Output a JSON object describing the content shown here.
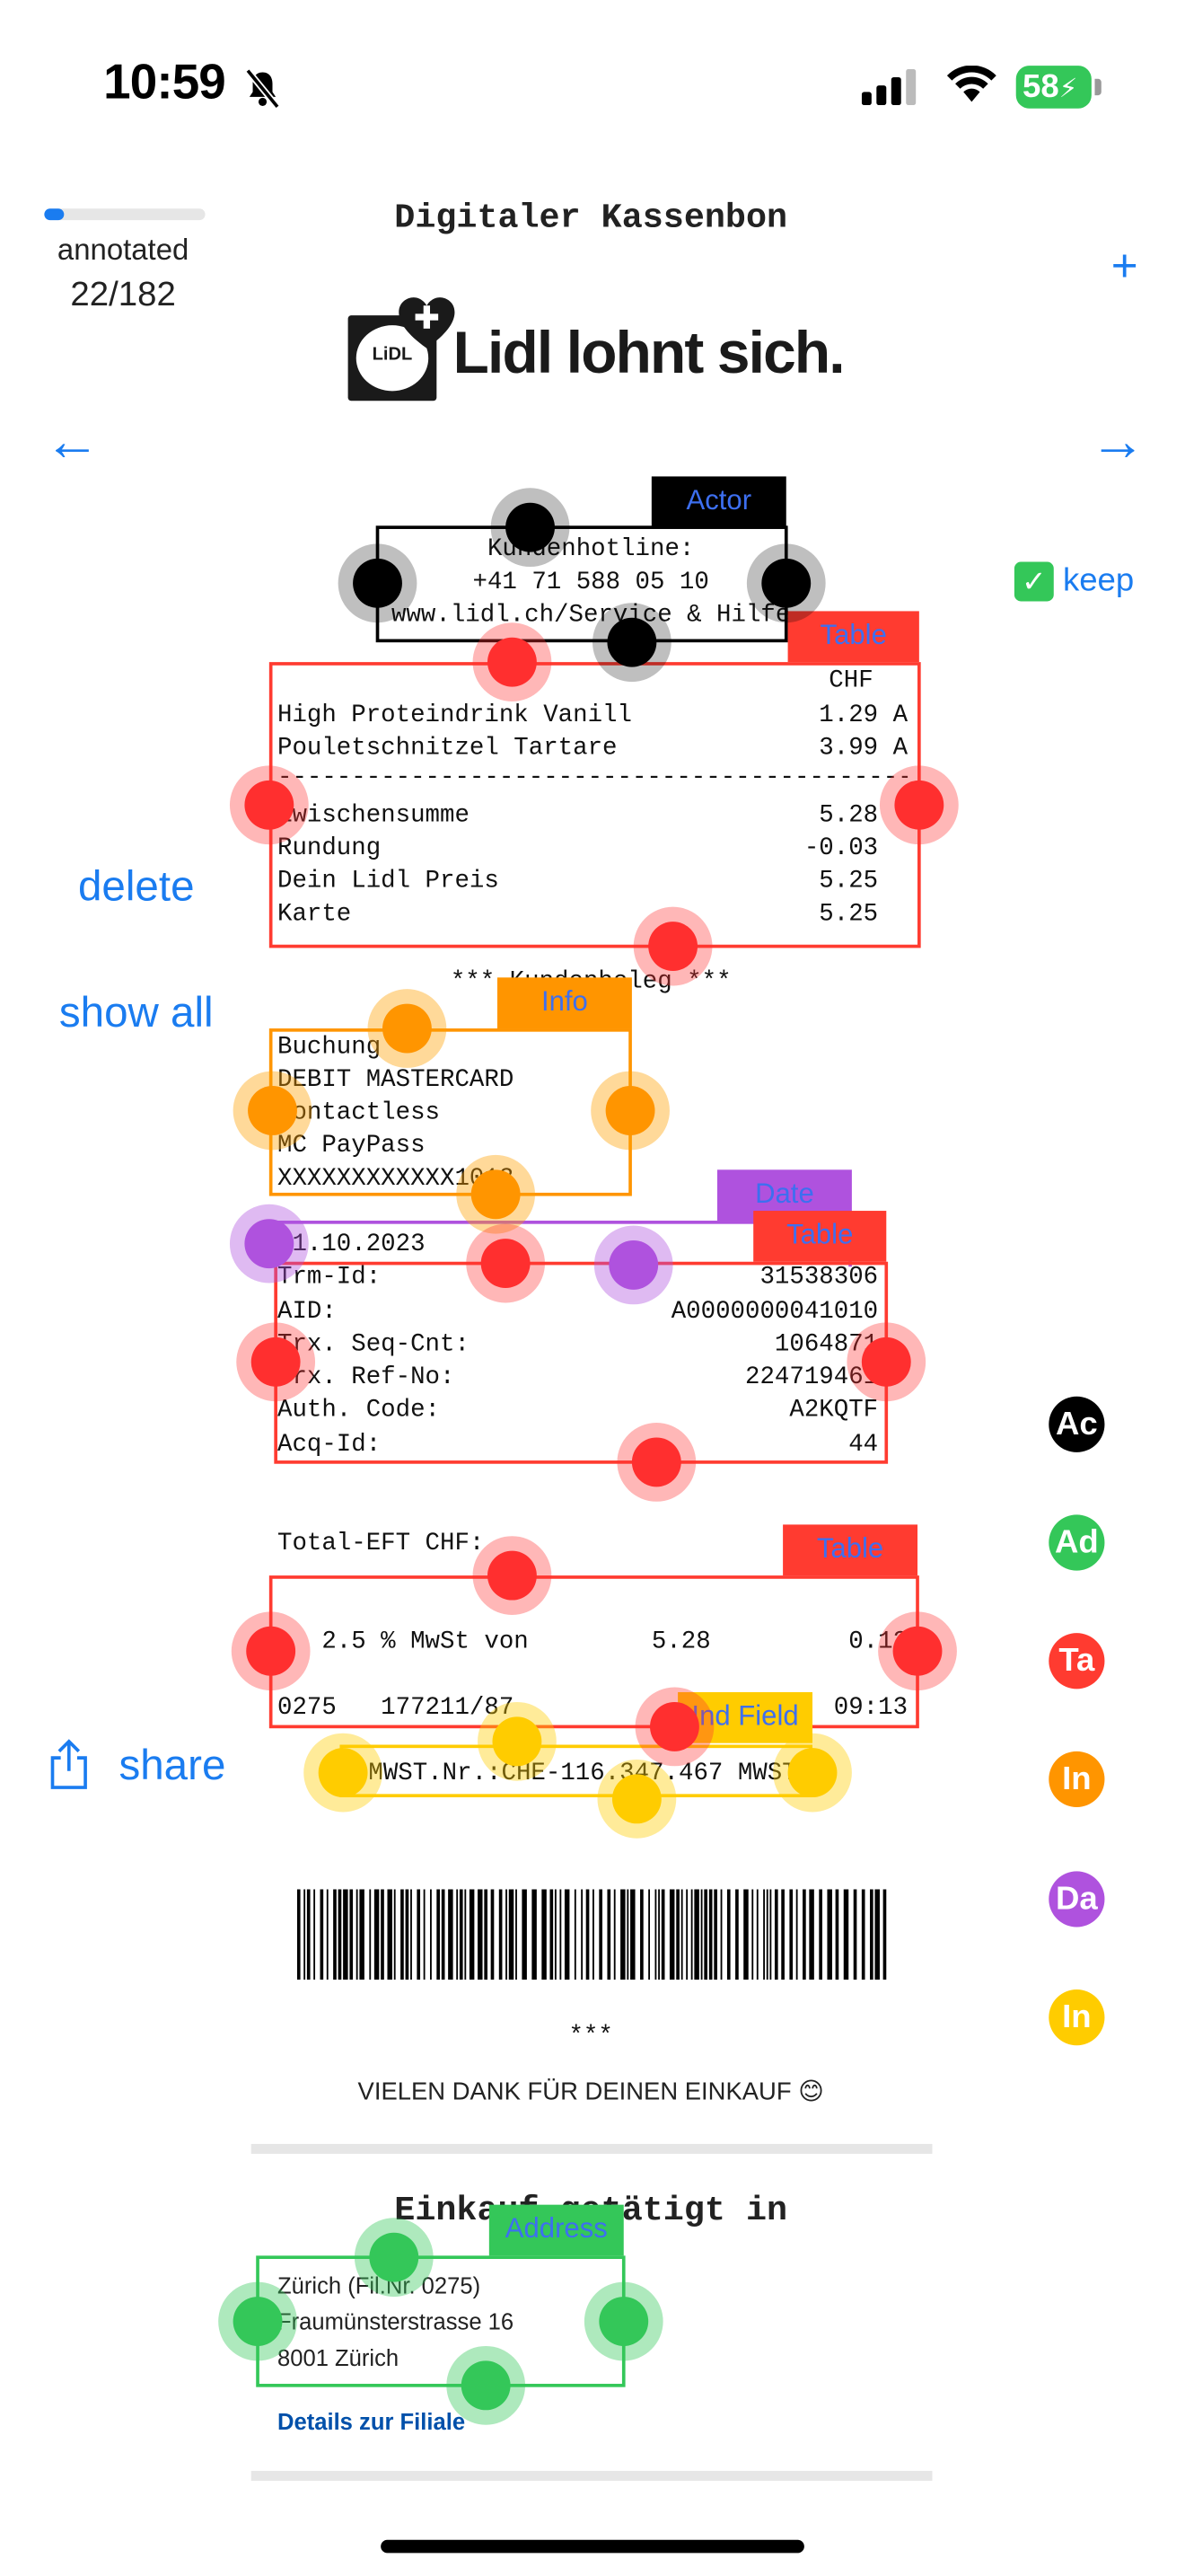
{
  "status_bar": {
    "time": "10:59",
    "battery": "58"
  },
  "progress": {
    "label": "annotated",
    "count": "22/182",
    "fraction": 0.1209
  },
  "header": {
    "title": "Digitaler Kassenbon",
    "add_glyph": "+"
  },
  "logo": {
    "text": "Lidl lohnt sich.",
    "badge_text": "LiDL"
  },
  "nav": {
    "prev_glyph": "←",
    "next_glyph": "→"
  },
  "sidebar": {
    "keep_label": "keep",
    "delete_label": "delete",
    "show_all_label": "show all",
    "share_label": "share"
  },
  "receipt": {
    "hotline": [
      "Kundenhotline:",
      "+41 71 588 05 10",
      "www.lidl.ch/Service & Hilfe"
    ],
    "currency": "CHF",
    "items": [
      {
        "name": "High Proteindrink Vanill",
        "price": "1.29 A"
      },
      {
        "name": "Pouletschnitzel Tartare",
        "price": "3.99 A"
      }
    ],
    "divider": "---------------------------------------------",
    "totals": [
      {
        "name": "Zwischensumme",
        "value": "5.28"
      },
      {
        "name": "Rundung",
        "value": "-0.03"
      },
      {
        "name": "Dein Lidl Preis",
        "value": "5.25"
      },
      {
        "name": "Karte",
        "value": "5.25"
      }
    ],
    "kundenbeleg": "*** Kundenbeleg ***",
    "payment": [
      "Buchung",
      "DEBIT MASTERCARD",
      "Contactless",
      "MC PayPass",
      "XXXXXXXXXXXX1013"
    ],
    "date": "01.10.2023",
    "eft": [
      {
        "name": "Trm-Id:",
        "value": "31538306"
      },
      {
        "name": "AID:",
        "value": "A0000000041010"
      },
      {
        "name": "Trx. Seq-Cnt:",
        "value": "1064871"
      },
      {
        "name": "Trx. Ref-No:",
        "value": "224719461"
      },
      {
        "name": "Auth. Code:",
        "value": "A2KQTF"
      },
      {
        "name": "Acq-Id:",
        "value": "44"
      }
    ],
    "total_eft": "Total-EFT CHF:",
    "vat": {
      "rate": "2.5 % MwSt von",
      "base": "5.28",
      "amount": "0.13"
    },
    "footer_row": {
      "store": "0275",
      "code": "177211/87",
      "time": "09:13"
    },
    "vat_id": "MWST.Nr.:CHE-116.347.467 MWST",
    "stars": "***",
    "thanks": "VIELEN DANK FÜR DEINEN EINKAUF 😊",
    "purchase_title": "Einkauf getätigt in",
    "address": [
      "Zürich (Fil.Nr. 0275)",
      "Fraumünsterstrasse 16",
      "8001 Zürich"
    ],
    "details_link": "Details zur Filiale"
  },
  "annotations": [
    {
      "label": "Actor",
      "color": "#000000"
    },
    {
      "label": "Table",
      "color": "#ff3b30"
    },
    {
      "label": "Info",
      "color": "#ff9500"
    },
    {
      "label": "Date",
      "color": "#af52de"
    },
    {
      "label": "Table",
      "color": "#ff3b30"
    },
    {
      "label": "Table",
      "color": "#ff3b30"
    },
    {
      "label": "Ind Field",
      "color": "#ffcc00"
    },
    {
      "label": "Address",
      "color": "#34c759"
    }
  ],
  "category_chips": [
    {
      "abbr": "Ac",
      "color": "#000000"
    },
    {
      "abbr": "Ad",
      "color": "#34c759"
    },
    {
      "abbr": "Ta",
      "color": "#ff3b30"
    },
    {
      "abbr": "In",
      "color": "#ff9500"
    },
    {
      "abbr": "Da",
      "color": "#af52de"
    },
    {
      "abbr": "In",
      "color": "#ffcc00"
    }
  ]
}
